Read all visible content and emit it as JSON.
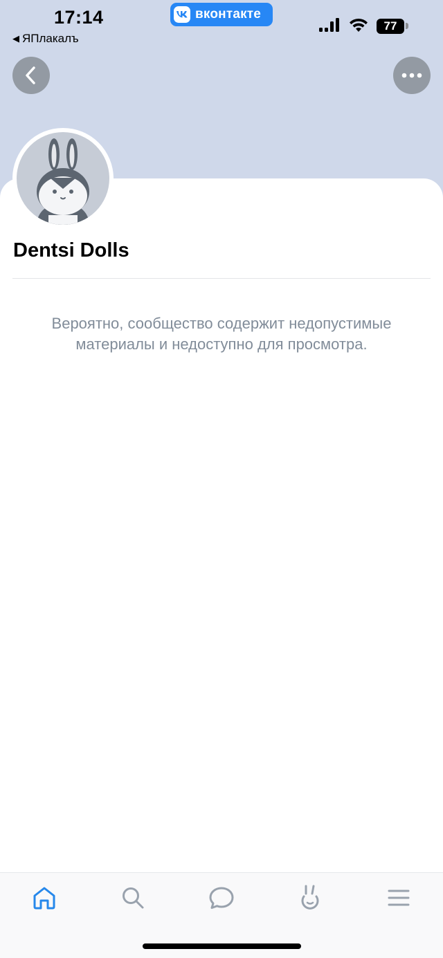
{
  "status_bar": {
    "time": "17:14",
    "back_app_label": "ЯПлакалъ",
    "app_badge_label": "вконтакте",
    "battery_level": "77"
  },
  "header": {
    "back_icon": "chevron-left-icon",
    "more_icon": "more-horizontal-icon",
    "background_color": "#cfd8ea"
  },
  "profile": {
    "name": "Dentsi Dolls",
    "avatar_icon": "bunny-avatar-icon"
  },
  "main": {
    "message": "Вероятно, сообщество содержит недопустимые материалы и недоступно для просмотра."
  },
  "tabbar": {
    "items": [
      {
        "name": "home",
        "icon": "home-icon",
        "active": true
      },
      {
        "name": "search",
        "icon": "search-icon",
        "active": false
      },
      {
        "name": "messages",
        "icon": "chat-bubble-icon",
        "active": false
      },
      {
        "name": "clips",
        "icon": "bunny-icon",
        "active": false
      },
      {
        "name": "menu",
        "icon": "hamburger-menu-icon",
        "active": false
      }
    ],
    "active_color": "#2688eb",
    "inactive_color": "#99a2ad"
  }
}
